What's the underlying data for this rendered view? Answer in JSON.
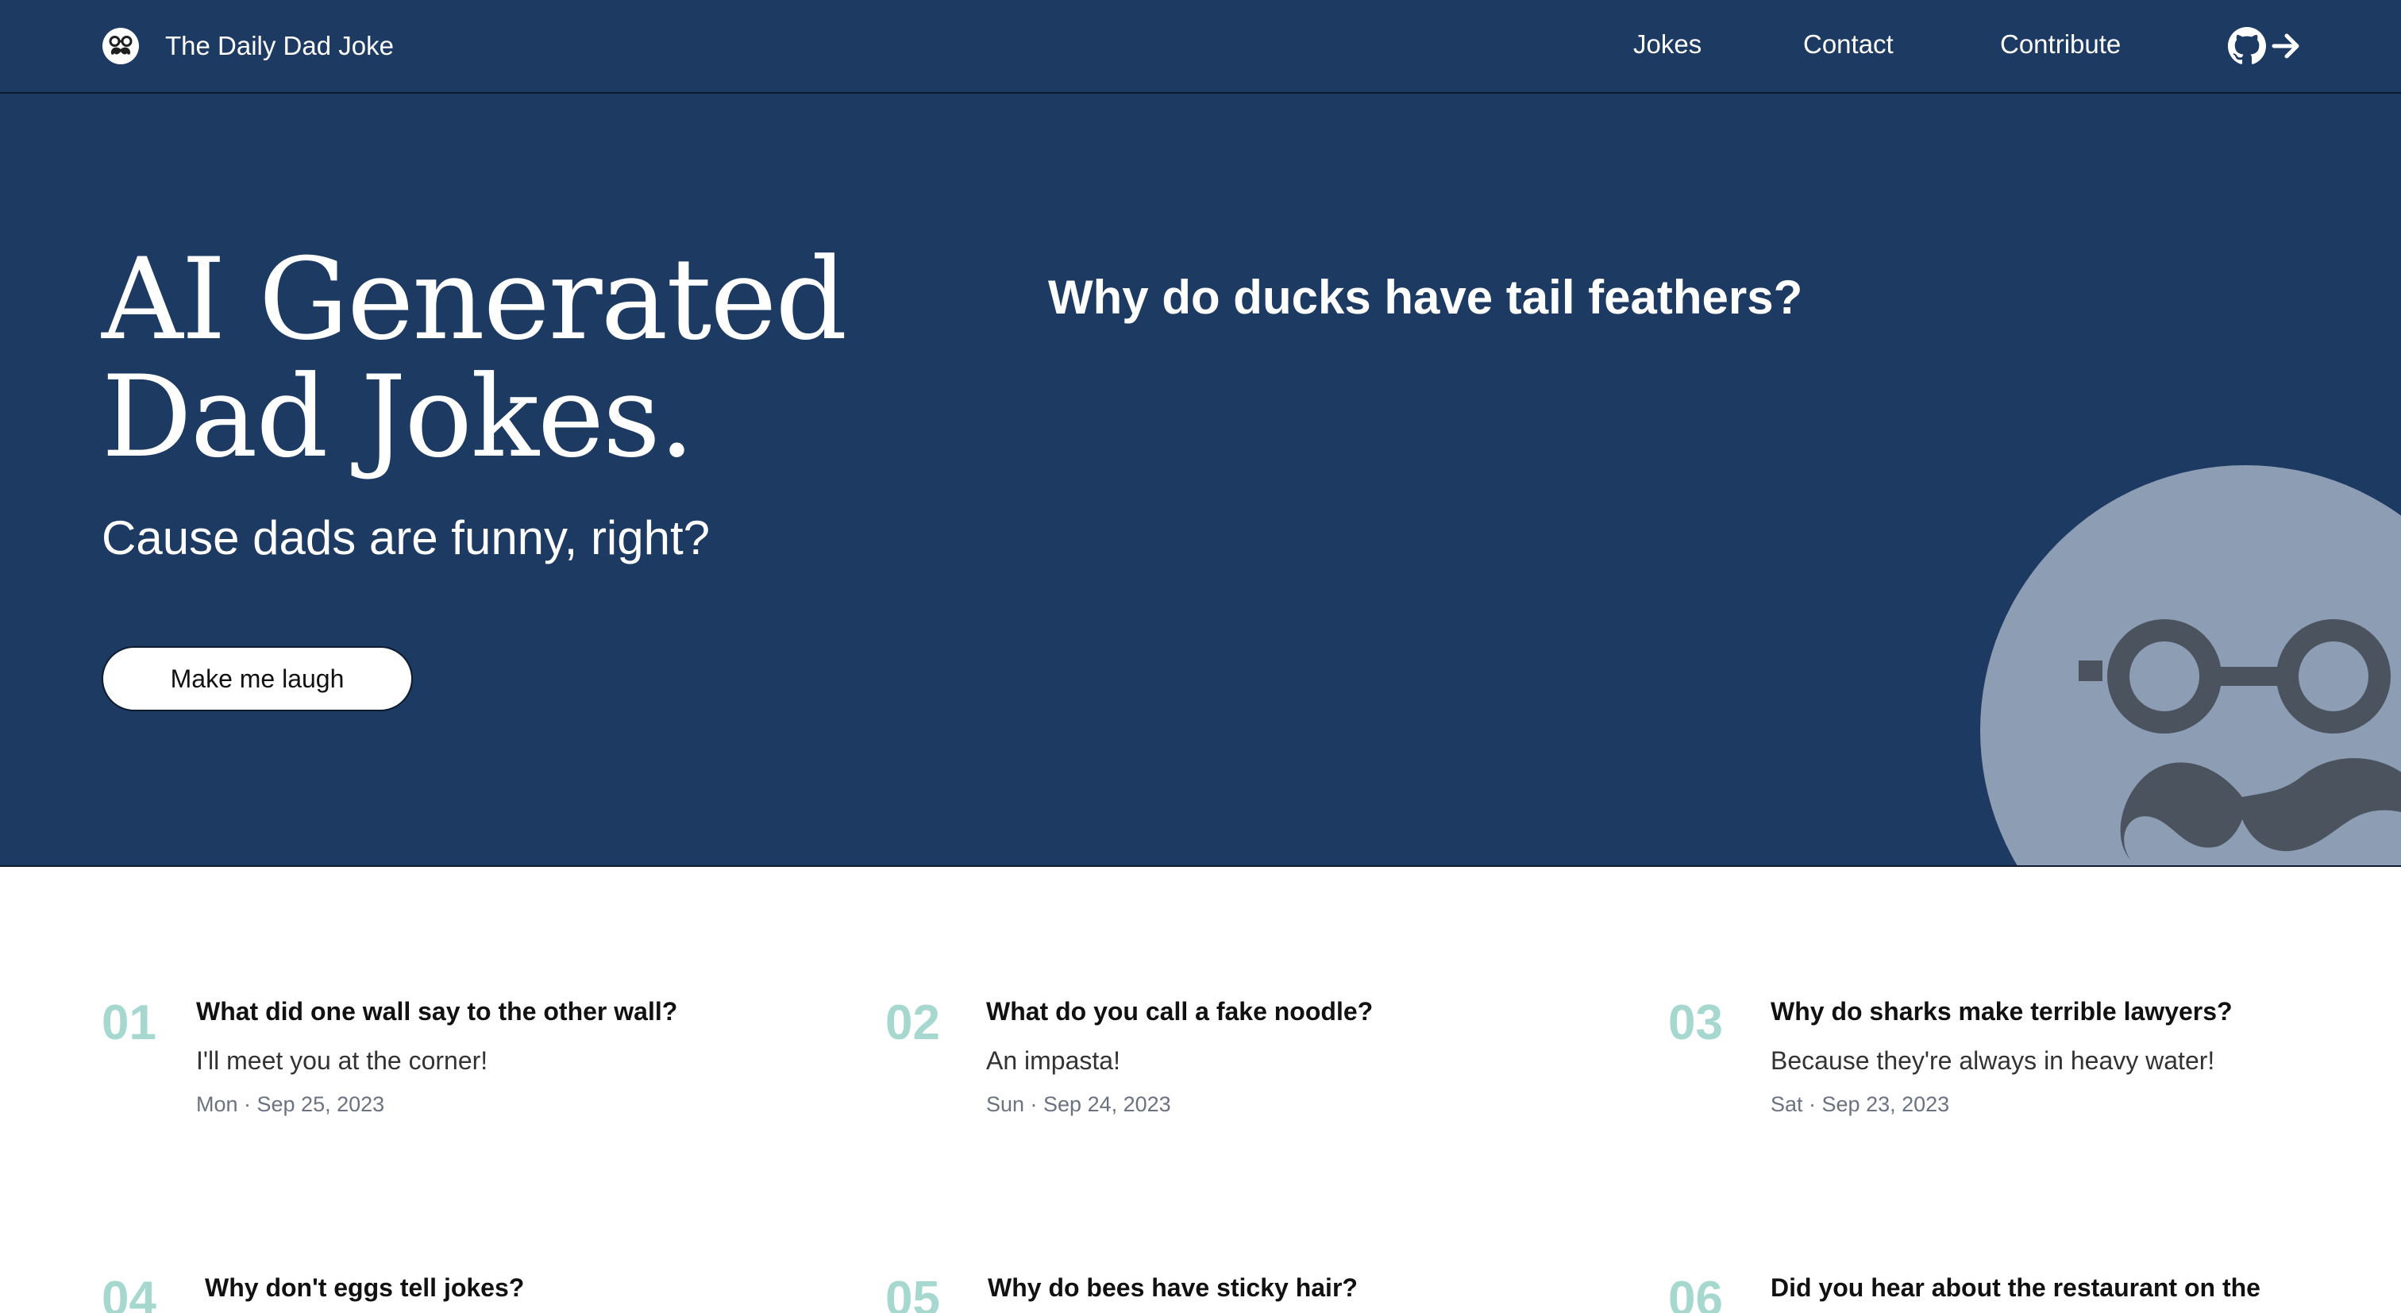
{
  "nav": {
    "brand": "The Daily Dad Joke",
    "links": [
      "Jokes",
      "Contact",
      "Contribute"
    ]
  },
  "hero": {
    "title_line1": "AI Generated",
    "title_line2": "Dad Jokes.",
    "subtitle": "Cause dads are funny, right?",
    "button": "Make me laugh",
    "joke_question": "Why do ducks have tail feathers?"
  },
  "jokes": [
    {
      "num": "01",
      "question": "What did one wall say to the other wall?",
      "answer": "I'll meet you at the corner!",
      "date": "Mon · Sep 25, 2023"
    },
    {
      "num": "02",
      "question": "What do you call a fake noodle?",
      "answer": "An impasta!",
      "date": "Sun · Sep 24, 2023"
    },
    {
      "num": "03",
      "question": "Why do sharks make terrible lawyers?",
      "answer": "Because they're always in heavy water!",
      "date": "Sat · Sep 23, 2023"
    },
    {
      "num": "04",
      "question": "Why don't eggs tell jokes?"
    },
    {
      "num": "05",
      "question": "Why do bees have sticky hair?"
    },
    {
      "num": "06",
      "question": "Did you hear about the restaurant on the"
    }
  ],
  "icons": {
    "brand": "mustache-glasses-logo-icon",
    "github": "github-icon",
    "arrow": "arrow-right-icon",
    "mascot": "mustache-glasses-mascot-icon"
  },
  "colors": {
    "header_bg": "#1d3a63",
    "number_accent": "#a6d8cf",
    "mascot_circle": "#8d9db4",
    "mascot_features": "#4a535e"
  }
}
